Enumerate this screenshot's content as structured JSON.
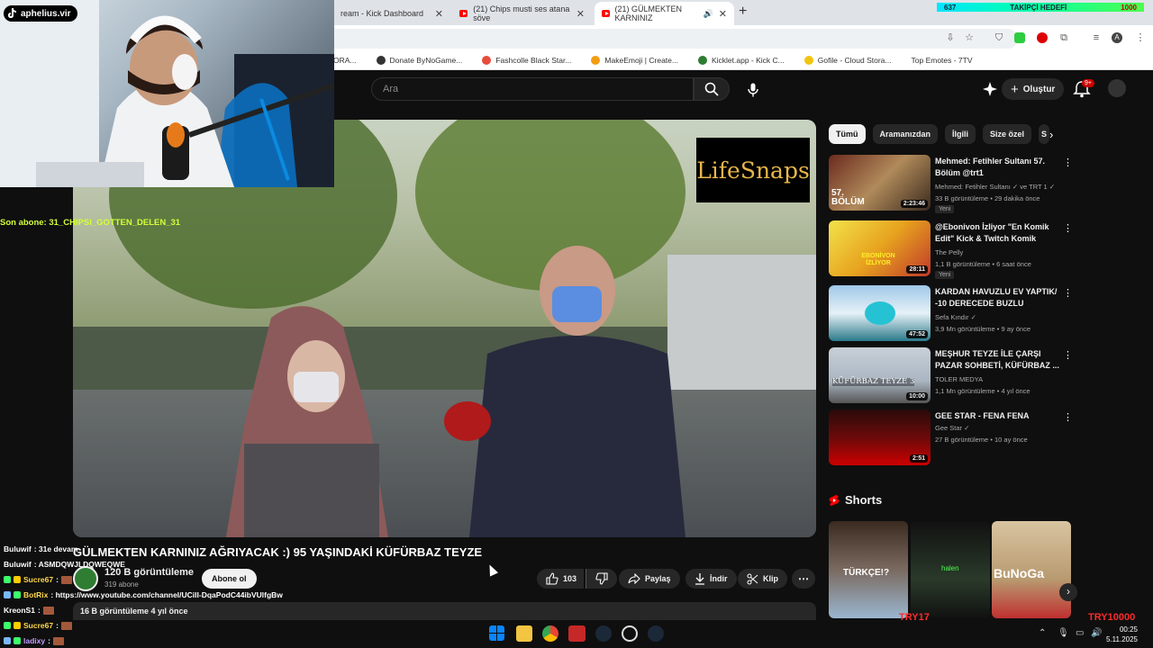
{
  "browser": {
    "tabs": [
      {
        "label": "ream - Kick Dashboard"
      },
      {
        "label": "(21) Chips musti ses atana söve"
      },
      {
        "label": "(21) GÜLMEKTEN KARNINIZ"
      }
    ],
    "bookmarks": [
      "ORA...",
      "Donate ByNoGame...",
      "Fashcolle Black Star...",
      "MakeEmoji | Create...",
      "Kicklet.app - Kick C...",
      "Gofile - Cloud Stora...",
      "Top Emotes - 7TV"
    ]
  },
  "follower_goal": {
    "left": "637",
    "center": "TAKİPÇİ HEDEFİ",
    "right": "1000"
  },
  "youtube": {
    "search_placeholder": "Ara",
    "create_label": "Oluştur",
    "notif_count": "9+"
  },
  "video": {
    "watermark": "LifeSnaps",
    "title": "GÜLMEKTEN KARNINIZ AĞRIYACAK :) 95 YAŞINDAKİ KÜFÜRBAZ TEYZE",
    "channel_name": "120 B görüntüleme",
    "channel_subs": "319 abone",
    "subscribe_label": "Abone ol",
    "likes": "103",
    "share_label": "Paylaş",
    "download_label": "İndir",
    "clip_label": "Klip",
    "description": "16 B görüntüleme  4 yıl önce"
  },
  "chips": [
    "Tümü",
    "Aramanızdan",
    "İlgili",
    "Size özel",
    "S"
  ],
  "recommendations": [
    {
      "title": "Mehmed: Fetihler Sultanı 57. Bölüm @trt1",
      "channel": "Mehmed: Fetihler Sultanı ✓ ve TRT 1 ✓",
      "meta": "33 B görüntüleme • 29 dakika önce",
      "badge": "Yeni",
      "duration": "2:23:46",
      "thumb_text": "57. BÖLÜM"
    },
    {
      "title": "@Ebonivon İzliyor \"En Komik Edit\" Kick & Twitch Komik Anla...",
      "channel": "The Pelly",
      "meta": "1,1 B görüntüleme • 6 saat önce",
      "badge": "Yeni",
      "duration": "28:11",
      "thumb_text": "EBONİVON İZLİYOR"
    },
    {
      "title": "KARDAN HAVUZLU EV YAPTIK/ -10 DERECEDE BUZLU HAVUZ...",
      "channel": "Sefa Kındır ✓",
      "meta": "3,9 Mn görüntüleme • 9 ay önce",
      "badge": "",
      "duration": "47:52",
      "thumb_text": ""
    },
    {
      "title": "MEŞHUR TEYZE İLE ÇARŞI PAZAR SOHBETİ, KÜFÜRBAZ ...",
      "channel": "TOLER MEDYA",
      "meta": "1,1 Mn görüntüleme • 4 yıl önce",
      "badge": "",
      "duration": "10:00",
      "thumb_text": "KÜFÜRBAZ TEYZE 3"
    },
    {
      "title": "GEE STAR - FENA FENA",
      "channel": "Gee Star ✓",
      "meta": "27 B görüntüleme • 10 ay önce",
      "badge": "",
      "duration": "2:51",
      "thumb_text": ""
    }
  ],
  "shorts": {
    "heading": "Shorts",
    "items": [
      {
        "thumb_text": "TÜRKÇE!?"
      },
      {
        "thumb_text": "halen"
      },
      {
        "thumb_text": "BuNoGa"
      }
    ]
  },
  "overlay": {
    "tiktok_handle": "aphelius.vir",
    "last_sub": "Son abone: 31_CHIPSI_GOTTEN_DELEN_31",
    "try_left": "TRY17",
    "try_right": "TRY10000",
    "chat": [
      {
        "user": "Buluwif",
        "msg": ": 31e devam",
        "color": "white"
      },
      {
        "user": "Buluwif",
        "msg": ": ASMDQWJLDQWEQWE",
        "color": "white"
      },
      {
        "user": "Sucre67",
        "msg": ":",
        "color": "yellow"
      },
      {
        "user": "BotRix",
        "msg": ": https://www.youtube.com/channel/UCilI-DqaPodC44ibVUlfgBw",
        "color": "yellow"
      },
      {
        "user": "KreonS1",
        "msg": ":",
        "color": "white"
      },
      {
        "user": "Sucre67",
        "msg": ":",
        "color": "yellow"
      },
      {
        "user": "ladixy",
        "msg": ":",
        "color": "purple"
      }
    ]
  },
  "taskbar": {
    "time": "00:25",
    "date": "5.11.2025"
  }
}
